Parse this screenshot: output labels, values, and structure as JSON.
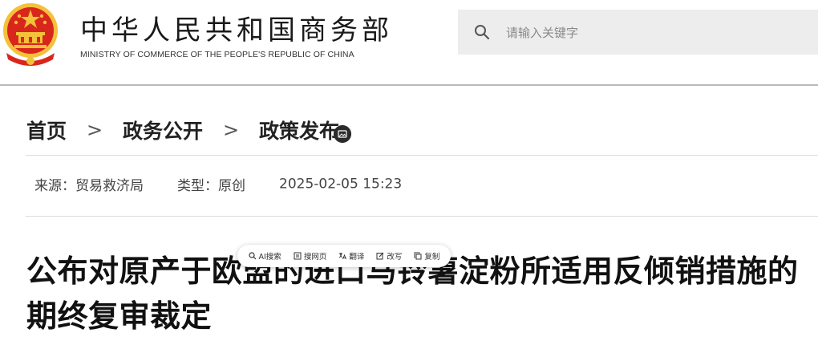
{
  "header": {
    "brand_cn": "中华人民共和国商务部",
    "brand_en": "MINISTRY OF COMMERCE OF THE PEOPLE'S REPUBLIC OF CHINA",
    "emblem_icon": "national-emblem-icon",
    "search": {
      "placeholder": "请输入关键字",
      "icon": "search-icon"
    }
  },
  "breadcrumb": [
    {
      "label": "首页"
    },
    {
      "label": "政务公开"
    },
    {
      "label": "政策发布"
    }
  ],
  "breadcrumb_separator": ">",
  "meta": {
    "source": "来源：贸易救济局",
    "type": "类型：原创",
    "datetime": "2025-02-05 15:23"
  },
  "article": {
    "title": "公布对原产于欧盟的进口马铃薯淀粉所适用反倾销措施的期终复审裁定"
  },
  "selection_toolbar": {
    "buttons": [
      {
        "label": "AI搜索",
        "icon": "search-icon"
      },
      {
        "label": "搜网页",
        "icon": "web-search-icon"
      },
      {
        "label": "翻译",
        "icon": "translate-icon"
      },
      {
        "label": "改写",
        "icon": "edit-icon"
      },
      {
        "label": "复制",
        "icon": "copy-icon"
      }
    ]
  },
  "colors": {
    "emblem_red": "#d9261c",
    "emblem_gold": "#f3c13a",
    "search_bg": "#ededed",
    "text_dark": "#111111"
  }
}
